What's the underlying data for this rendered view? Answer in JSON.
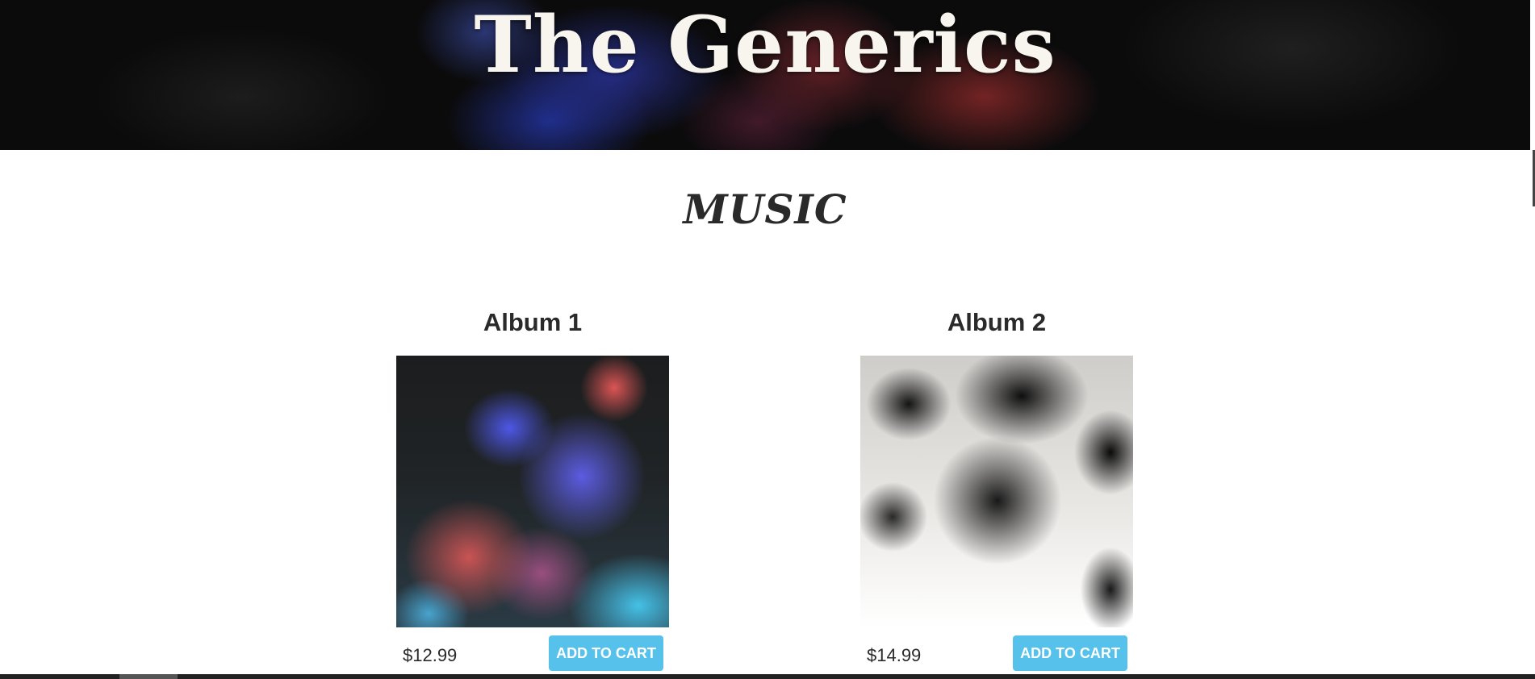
{
  "header": {
    "title": "The Generics"
  },
  "music": {
    "section_title": "MUSIC",
    "albums": [
      {
        "title": "Album 1",
        "price": "$12.99",
        "button_label": "ADD TO CART",
        "art": "colorful-smoke-blue-red"
      },
      {
        "title": "Album 2",
        "price": "$14.99",
        "button_label": "ADD TO CART",
        "art": "black-ink-smoke"
      }
    ]
  },
  "theme": {
    "accent": "#56c2ec",
    "text": "#2a2a2a",
    "banner_background": "#0b0b0c"
  }
}
